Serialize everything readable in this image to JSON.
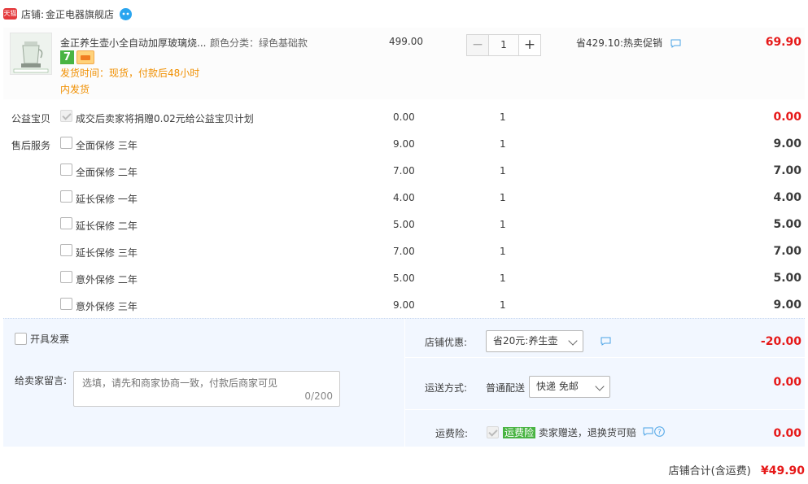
{
  "shop": {
    "badge": "天猫",
    "label": "店铺:",
    "name": "金正电器旗舰店",
    "chat_icon": "wangwang-icon"
  },
  "item": {
    "title": "金正养生壶小全自动加厚玻璃烧...",
    "sku": "颜色分类：绿色基础款",
    "badge_7": "7",
    "ship_line1": "发货时间：现货，付款后48小时",
    "ship_line2": "内发货",
    "unit_price": "499.00",
    "qty_minus": "−",
    "qty_value": "1",
    "qty_plus": "+",
    "promo": "省429.10:热卖促销",
    "subtotal": "69.90"
  },
  "charity": {
    "label": "公益宝贝",
    "name": "成交后卖家将捐赠0.02元给公益宝贝计划",
    "price": "0.00",
    "qty": "1",
    "total": "0.00"
  },
  "service": {
    "label": "售后服务",
    "options": [
      {
        "name": "全面保修 三年",
        "price": "9.00",
        "qty": "1",
        "total": "9.00"
      },
      {
        "name": "全面保修 二年",
        "price": "7.00",
        "qty": "1",
        "total": "7.00"
      },
      {
        "name": "延长保修 一年",
        "price": "4.00",
        "qty": "1",
        "total": "4.00"
      },
      {
        "name": "延长保修 二年",
        "price": "5.00",
        "qty": "1",
        "total": "5.00"
      },
      {
        "name": "延长保修 三年",
        "price": "7.00",
        "qty": "1",
        "total": "7.00"
      },
      {
        "name": "意外保修 二年",
        "price": "5.00",
        "qty": "1",
        "total": "5.00"
      },
      {
        "name": "意外保修 三年",
        "price": "9.00",
        "qty": "1",
        "total": "9.00"
      }
    ]
  },
  "footer": {
    "invoice_label": "开具发票",
    "message_label": "给卖家留言:",
    "message_placeholder": "选填，请先和商家协商一致，付款后商家可见",
    "message_count": "0/200",
    "discount_label": "店铺优惠:",
    "discount_value": "省20元:养生壶",
    "discount_amount": "-20.00",
    "delivery_label": "运送方式:",
    "delivery_type": "普通配送",
    "delivery_value": "快递 免邮",
    "delivery_amount": "0.00",
    "insurance_label": "运费险:",
    "insurance_tag": "运费险",
    "insurance_desc": "卖家赠送，退换货可赔",
    "insurance_amount": "0.00"
  },
  "total": {
    "label": "店铺合计(含运费)",
    "amount": "¥49.90"
  },
  "colors": {
    "price_red": "#e61919",
    "ship_orange": "#f08f00",
    "footer_bg": "#f2f7ff",
    "tmall_red": "#e4393c",
    "tag_green": "#49b443"
  }
}
